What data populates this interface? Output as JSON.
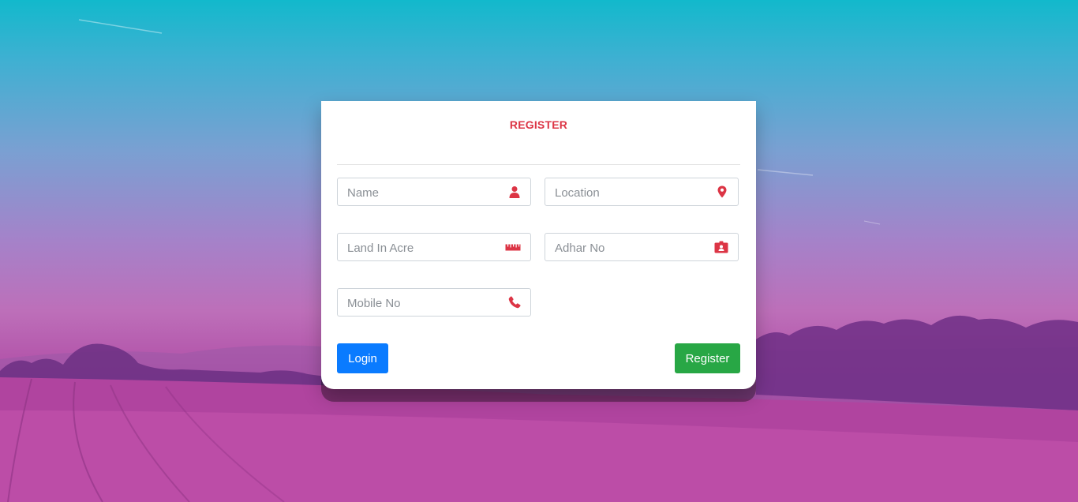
{
  "form": {
    "title": "REGISTER",
    "fields": {
      "name": {
        "placeholder": "Name",
        "icon": "user-icon"
      },
      "location": {
        "placeholder": "Location",
        "icon": "map-marker-icon"
      },
      "land": {
        "placeholder": "Land In Acre",
        "icon": "ruler-icon"
      },
      "adhar": {
        "placeholder": "Adhar No",
        "icon": "id-card-icon"
      },
      "mobile": {
        "placeholder": "Mobile No",
        "icon": "phone-icon"
      }
    },
    "buttons": {
      "login": "Login",
      "register": "Register"
    }
  },
  "colors": {
    "accent": "#dc3545",
    "login_button": "#0a7bff",
    "register_button": "#28a745"
  }
}
